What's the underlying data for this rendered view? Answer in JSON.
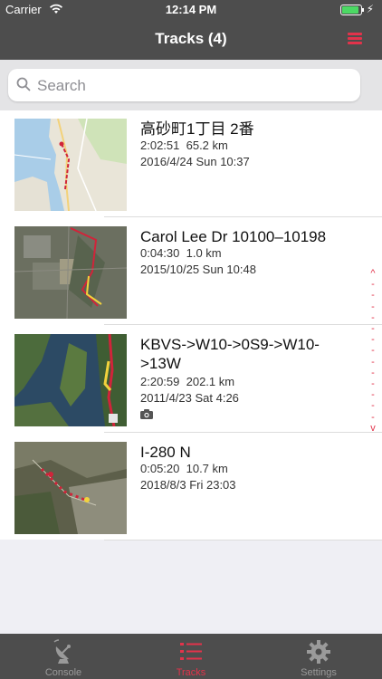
{
  "status_bar": {
    "carrier": "Carrier",
    "time": "12:14 PM"
  },
  "nav": {
    "title": "Tracks (4)",
    "menu_icon": "hamburger-menu-icon",
    "accent_color": "#e2334b"
  },
  "search": {
    "placeholder": "Search",
    "value": ""
  },
  "tracks": [
    {
      "name": "高砂町1丁目 2番",
      "duration": "2:02:51",
      "distance": "65.2 km",
      "date": "2016/4/24 Sun 10:37",
      "has_photo": false
    },
    {
      "name": "Carol Lee Dr 10100–10198",
      "duration": "0:04:30",
      "distance": "1.0 km",
      "date": "2015/10/25 Sun 10:48",
      "has_photo": false
    },
    {
      "name": "KBVS->W10->0S9->W10->13W",
      "duration": "2:20:59",
      "distance": "202.1 km",
      "date": "2011/4/23 Sat 4:26",
      "has_photo": true
    },
    {
      "name": "I-280 N",
      "duration": "0:05:20",
      "distance": "10.7 km",
      "date": "2018/8/3 Fri 23:03",
      "has_photo": false
    }
  ],
  "index_bar": {
    "top": "^",
    "bottom": "v"
  },
  "tab_bar": {
    "tabs": [
      {
        "label": "Console",
        "icon": "satellite-dish-icon",
        "active": false
      },
      {
        "label": "Tracks",
        "icon": "list-icon",
        "active": true
      },
      {
        "label": "Settings",
        "icon": "gear-icon",
        "active": false
      }
    ]
  }
}
